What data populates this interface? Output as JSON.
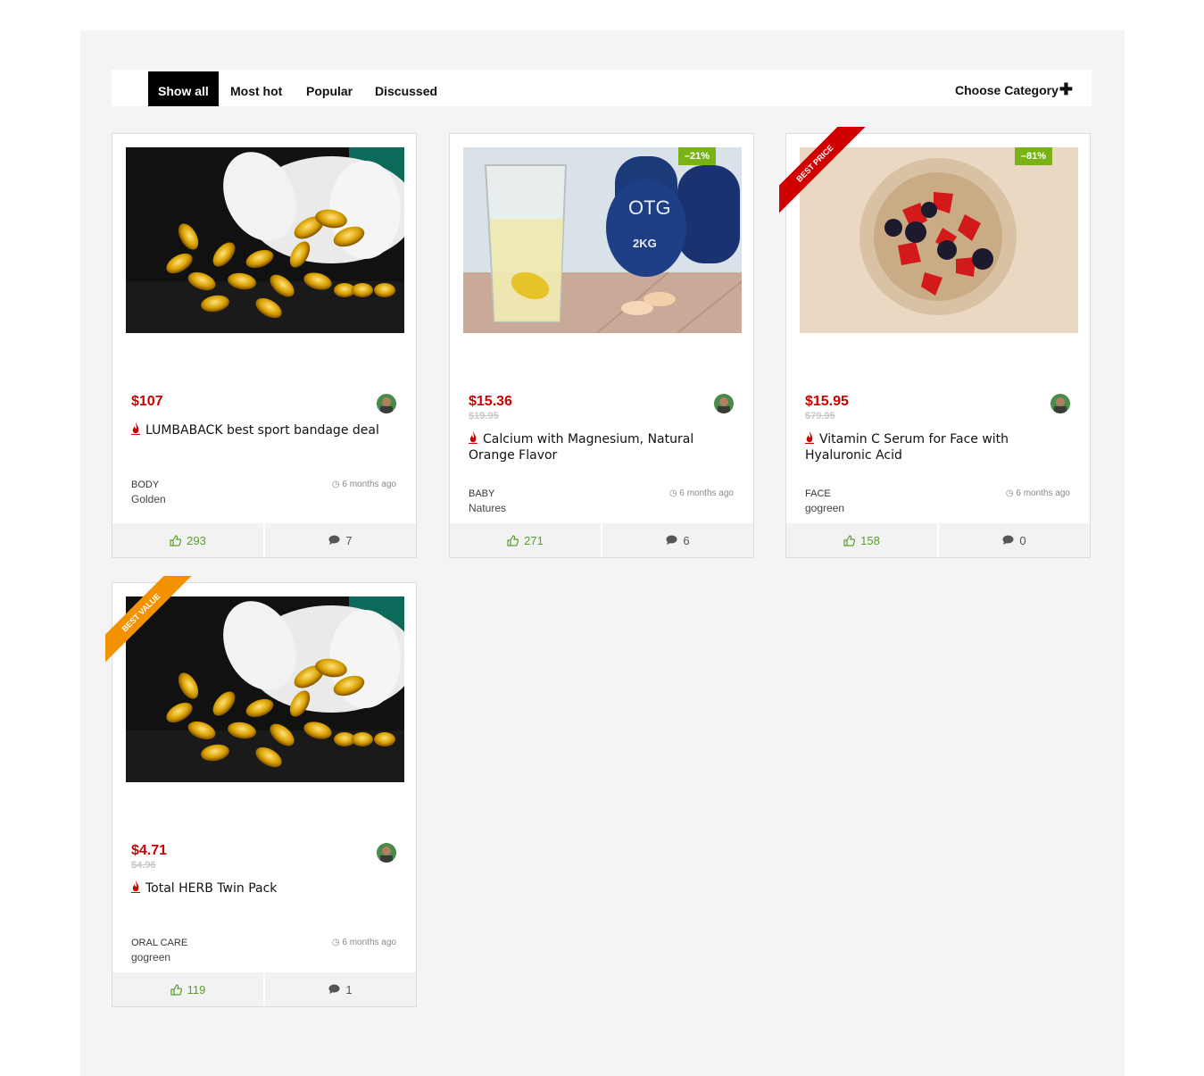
{
  "filters": {
    "tabs": [
      {
        "label": "Show all"
      },
      {
        "label": "Most hot"
      },
      {
        "label": "Popular"
      },
      {
        "label": "Discussed"
      }
    ],
    "choose_category": "Choose Category"
  },
  "deals": [
    {
      "price": "$107",
      "old_price": "",
      "title": "LUMBABACK best sport bandage deal",
      "category": "BODY",
      "store": "Golden",
      "time": "6 months ago",
      "likes": "293",
      "comments": "7",
      "discount": "",
      "ribbon": "",
      "image": "capsules"
    },
    {
      "price": "$15.36",
      "old_price": "$19.95",
      "title": "Calcium with Magnesium, Natural Orange Flavor",
      "category": "BABY",
      "store": "Natures",
      "time": "6 months ago",
      "likes": "271",
      "comments": "6",
      "discount": "–21%",
      "ribbon": "",
      "image": "fizzy-glass"
    },
    {
      "price": "$15.95",
      "old_price": "$79.95",
      "title": "Vitamin C Serum for Face with Hyaluronic Acid",
      "category": "FACE",
      "store": "gogreen",
      "time": "6 months ago",
      "likes": "158",
      "comments": "0",
      "discount": "–81%",
      "ribbon": "BEST PRICE",
      "image": "berries"
    },
    {
      "price": "$4.71",
      "old_price": "$4.96",
      "title": "Total HERB Twin Pack",
      "category": "ORAL CARE",
      "store": "gogreen",
      "time": "6 months ago",
      "likes": "119",
      "comments": "1",
      "discount": "",
      "ribbon": "BEST VALUE",
      "image": "capsules"
    }
  ],
  "colors": {
    "price": "#cc0000",
    "likes": "#5a9e2f",
    "discount_badge": "#79b318",
    "ribbon_best_price": "#d10000",
    "ribbon_best_value": "#f39200",
    "active_tab": "#000000"
  },
  "icons": {
    "thumbs_up": "thumbs-up-icon",
    "comment": "comment-icon",
    "clock": "clock-icon",
    "flame": "flame-icon",
    "plus": "plus-icon"
  }
}
